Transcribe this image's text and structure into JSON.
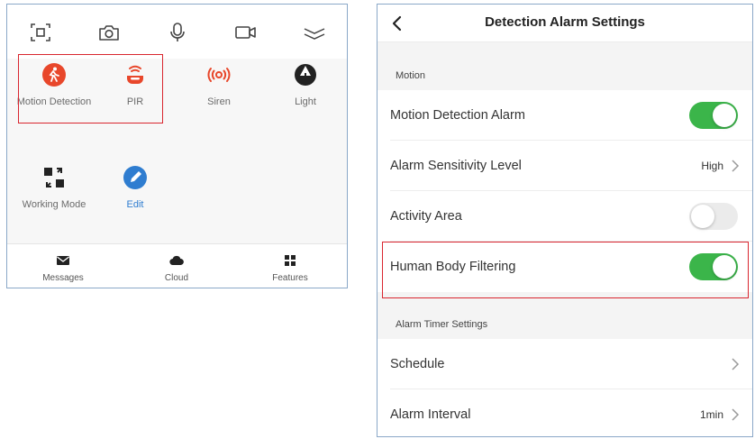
{
  "left_panel": {
    "toolbar": [
      {
        "icon": "screenshot-icon"
      },
      {
        "icon": "camera-icon"
      },
      {
        "icon": "microphone-icon"
      },
      {
        "icon": "video-record-icon"
      },
      {
        "icon": "collapse-chevron-icon"
      }
    ],
    "features": {
      "motion_detection": {
        "label": "Motion Detection",
        "icon": "motion-detection-icon",
        "color": "#e8472b"
      },
      "pir": {
        "label": "PIR",
        "icon": "pir-icon",
        "color": "#e8472b"
      },
      "siren": {
        "label": "Siren",
        "icon": "siren-icon",
        "color": "#e8472b"
      },
      "light": {
        "label": "Light",
        "icon": "light-icon"
      },
      "working_mode": {
        "label": "Working Mode",
        "icon": "working-mode-icon"
      },
      "edit": {
        "label": "Edit",
        "icon": "edit-icon",
        "color": "#2f7dd0"
      }
    },
    "bottom_nav": {
      "messages": {
        "label": "Messages",
        "icon": "messages-icon"
      },
      "cloud": {
        "label": "Cloud",
        "icon": "cloud-icon"
      },
      "features": {
        "label": "Features",
        "icon": "features-grid-icon"
      }
    }
  },
  "right_panel": {
    "header": {
      "title": "Detection Alarm Settings",
      "back_icon": "back-chevron-icon"
    },
    "sections": {
      "motion": "Motion",
      "alarm_timer": "Alarm Timer Settings"
    },
    "rows": {
      "motion_detection_alarm": {
        "label": "Motion Detection Alarm",
        "enabled": true
      },
      "alarm_sensitivity": {
        "label": "Alarm Sensitivity Level",
        "value": "High"
      },
      "activity_area": {
        "label": "Activity Area",
        "enabled": false
      },
      "human_body_filtering": {
        "label": "Human Body Filtering",
        "enabled": true
      },
      "schedule": {
        "label": "Schedule"
      },
      "alarm_interval": {
        "label": "Alarm Interval",
        "value": "1min"
      }
    },
    "toggle_on_color": "#3bb54a",
    "highlight_color": "#d9262f"
  }
}
